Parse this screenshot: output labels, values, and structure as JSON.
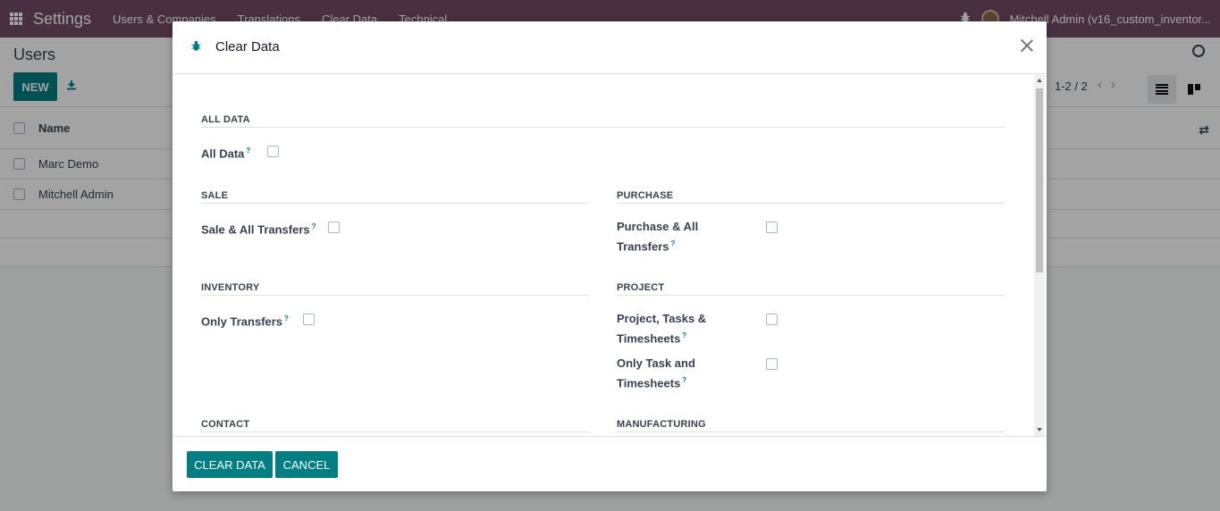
{
  "navbar": {
    "brand": "Settings",
    "menu": [
      "Users & Companies",
      "Translations",
      "Clear Data",
      "Technical"
    ],
    "user": "Mitchell Admin (v16_custom_inventor..."
  },
  "control_panel": {
    "title": "Users",
    "new_label": "NEW",
    "pager": "1-2 / 2"
  },
  "list": {
    "column_name": "Name",
    "rows": [
      "Marc Demo",
      "Mitchell Admin"
    ]
  },
  "dialog": {
    "title": "Clear Data",
    "sections": {
      "all_data": {
        "title": "ALL DATA",
        "fields": [
          "All Data"
        ]
      },
      "sale": {
        "title": "SALE",
        "fields": [
          "Sale & All Transfers"
        ]
      },
      "purchase": {
        "title": "PURCHASE",
        "fields": [
          "Purchase & All",
          "Transfers"
        ]
      },
      "inventory": {
        "title": "INVENTORY",
        "fields": [
          "Only Transfers"
        ]
      },
      "project": {
        "title": "PROJECT",
        "fields": [
          "Project, Tasks &",
          "Timesheets",
          "Only Task and",
          "Timesheets"
        ]
      },
      "contact": {
        "title": "CONTACT"
      },
      "manufacturing": {
        "title": "MANUFACTURING"
      }
    },
    "help_mark": "?",
    "buttons": {
      "clear": "CLEAR DATA",
      "cancel": "CANCEL"
    }
  },
  "colors": {
    "navbar": "#714b67",
    "primary": "#017e84"
  }
}
